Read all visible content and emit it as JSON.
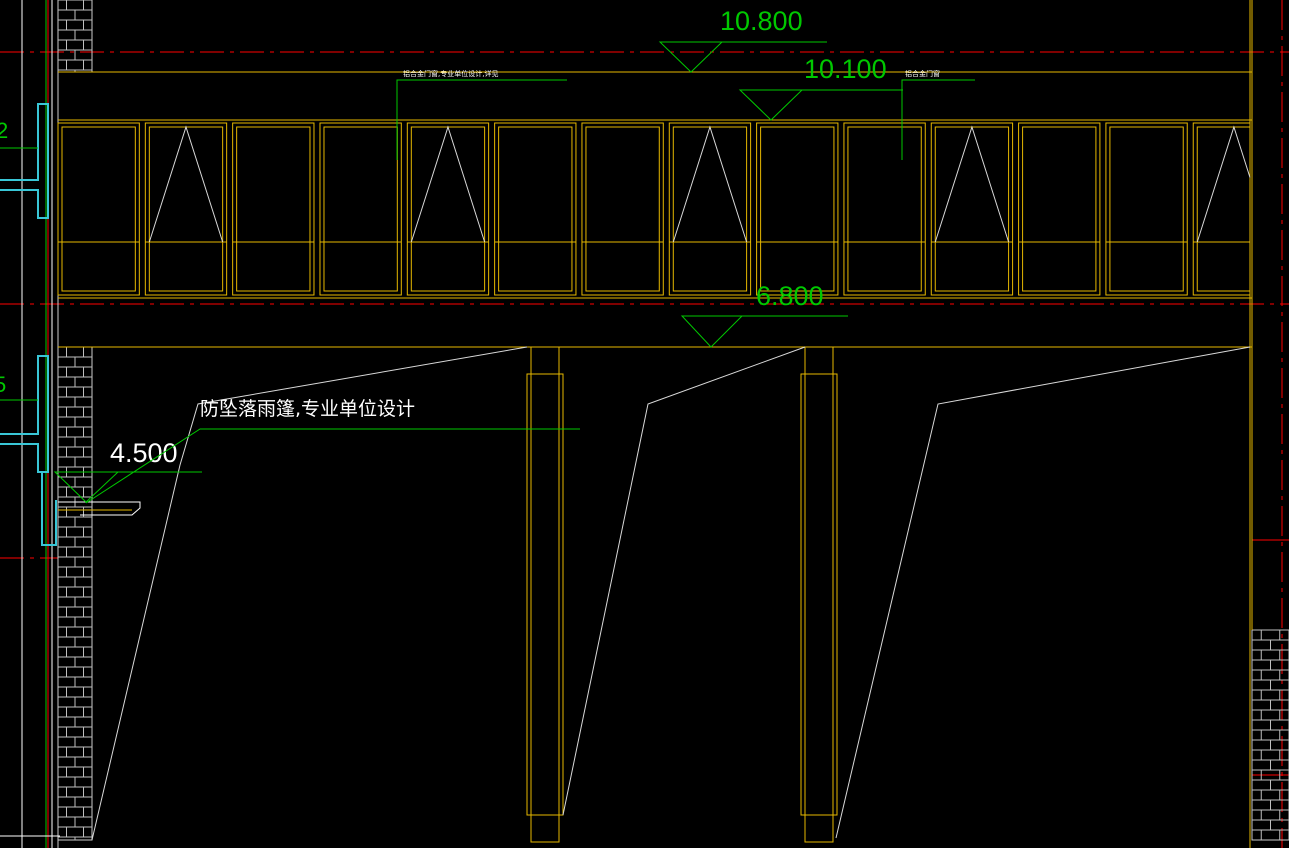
{
  "drawing": {
    "background_color": "#000000",
    "colors": {
      "frame": "#e6b800",
      "axis": "#ff0000",
      "dimension": "#00c800",
      "wall": "#cccccc",
      "slab_edge": "#39c6d6",
      "hatch_line": "#bfbfbf"
    },
    "elevations": [
      {
        "label": "10.800"
      },
      {
        "label": "10.100"
      },
      {
        "label": "6.800"
      },
      {
        "label": "4.500"
      }
    ],
    "notes": {
      "canopy_note": "防坠落雨篷,专业单位设计",
      "upper_leader_note": "铝合金门窗,专业单位设计,详见",
      "upper_right_note": "铝合金门窗"
    },
    "partial_labels": {
      "left_edge_upper": "2",
      "left_edge_lower": "5"
    },
    "window_panels": {
      "count": 14,
      "opening_marks": [
        false,
        true,
        false,
        false,
        true,
        false,
        false,
        true,
        false,
        false,
        true,
        false,
        false,
        true
      ]
    }
  }
}
